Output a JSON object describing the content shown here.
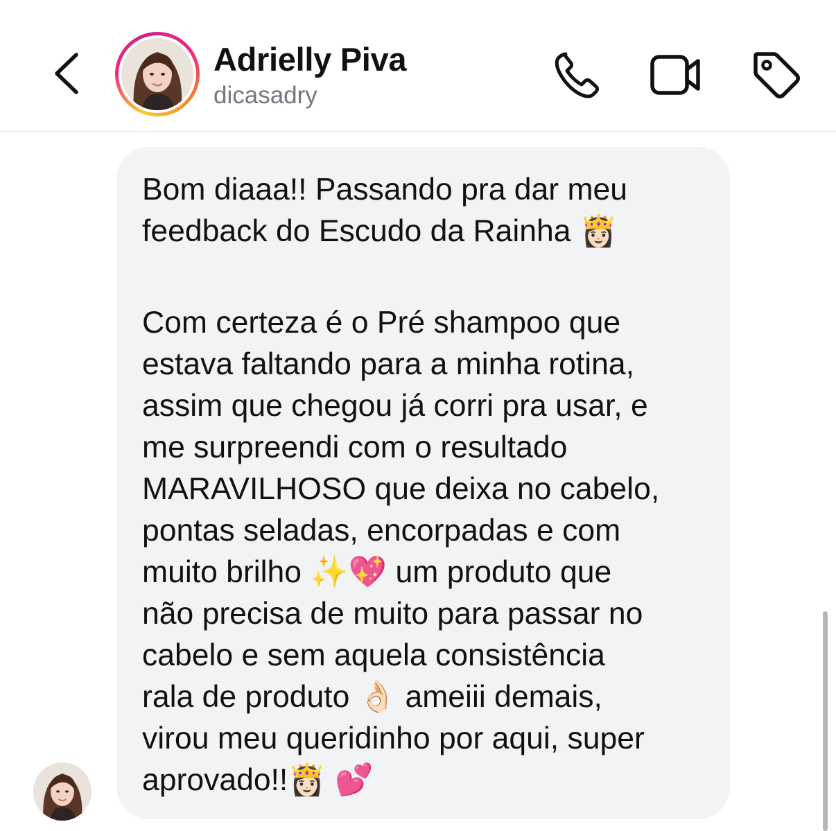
{
  "header": {
    "name": "Adrielly Piva",
    "username": "dicasadry",
    "back_icon": "chevron-left-icon",
    "call_icon": "phone-icon",
    "video_icon": "video-camera-icon",
    "tag_icon": "tag-icon",
    "story_ring_colors": [
      "#f9ce34",
      "#ee2a7b",
      "#d0208c",
      "#f58529"
    ]
  },
  "message": {
    "paragraph_1": "Bom diaaa!! Passando pra dar meu\nfeedback do Escudo da Rainha 👸🏻",
    "paragraph_2": "Com certeza é o Pré shampoo que\nestava faltando para a minha rotina,\nassim que chegou já corri pra usar, e\nme surpreendi com o resultado\nMARAVILHOSO que deixa no cabelo,\npontas seladas, encorpadas e com\nmuito brilho ✨💖 um produto que\nnão precisa de muito para passar no\ncabelo e sem aquela consistência\nrala de produto 👌🏻 ameiii demais,\nvirou meu queridinho por aqui, super\naprovado!!👸🏻 💕",
    "bubble_color": "#f2f3f5"
  }
}
